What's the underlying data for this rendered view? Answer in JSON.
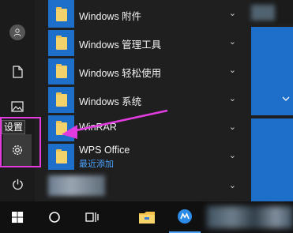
{
  "tooltip": {
    "settings": "设置"
  },
  "apps": [
    {
      "label": "Windows 附件",
      "expandable": true
    },
    {
      "label": "Windows 管理工具",
      "expandable": true
    },
    {
      "label": "Windows 轻松使用",
      "expandable": true
    },
    {
      "label": "Windows 系统",
      "expandable": true
    },
    {
      "label": "WinRAR",
      "expandable": true
    },
    {
      "label": "WPS Office",
      "sub": "最近添加",
      "expandable": true
    }
  ],
  "icons": {
    "rail": [
      "user-icon",
      "document-icon",
      "pictures-icon",
      "gear-icon",
      "power-icon"
    ],
    "taskbar": [
      "windows-start-icon",
      "cortana-search-icon",
      "task-view-icon",
      "file-explorer-icon",
      "maxthon-browser-icon"
    ]
  },
  "colors": {
    "accent": "#1e6fc9",
    "folder": "#f3d16b",
    "highlight": "#e23ce0",
    "recently_added": "#4aa3ff"
  }
}
